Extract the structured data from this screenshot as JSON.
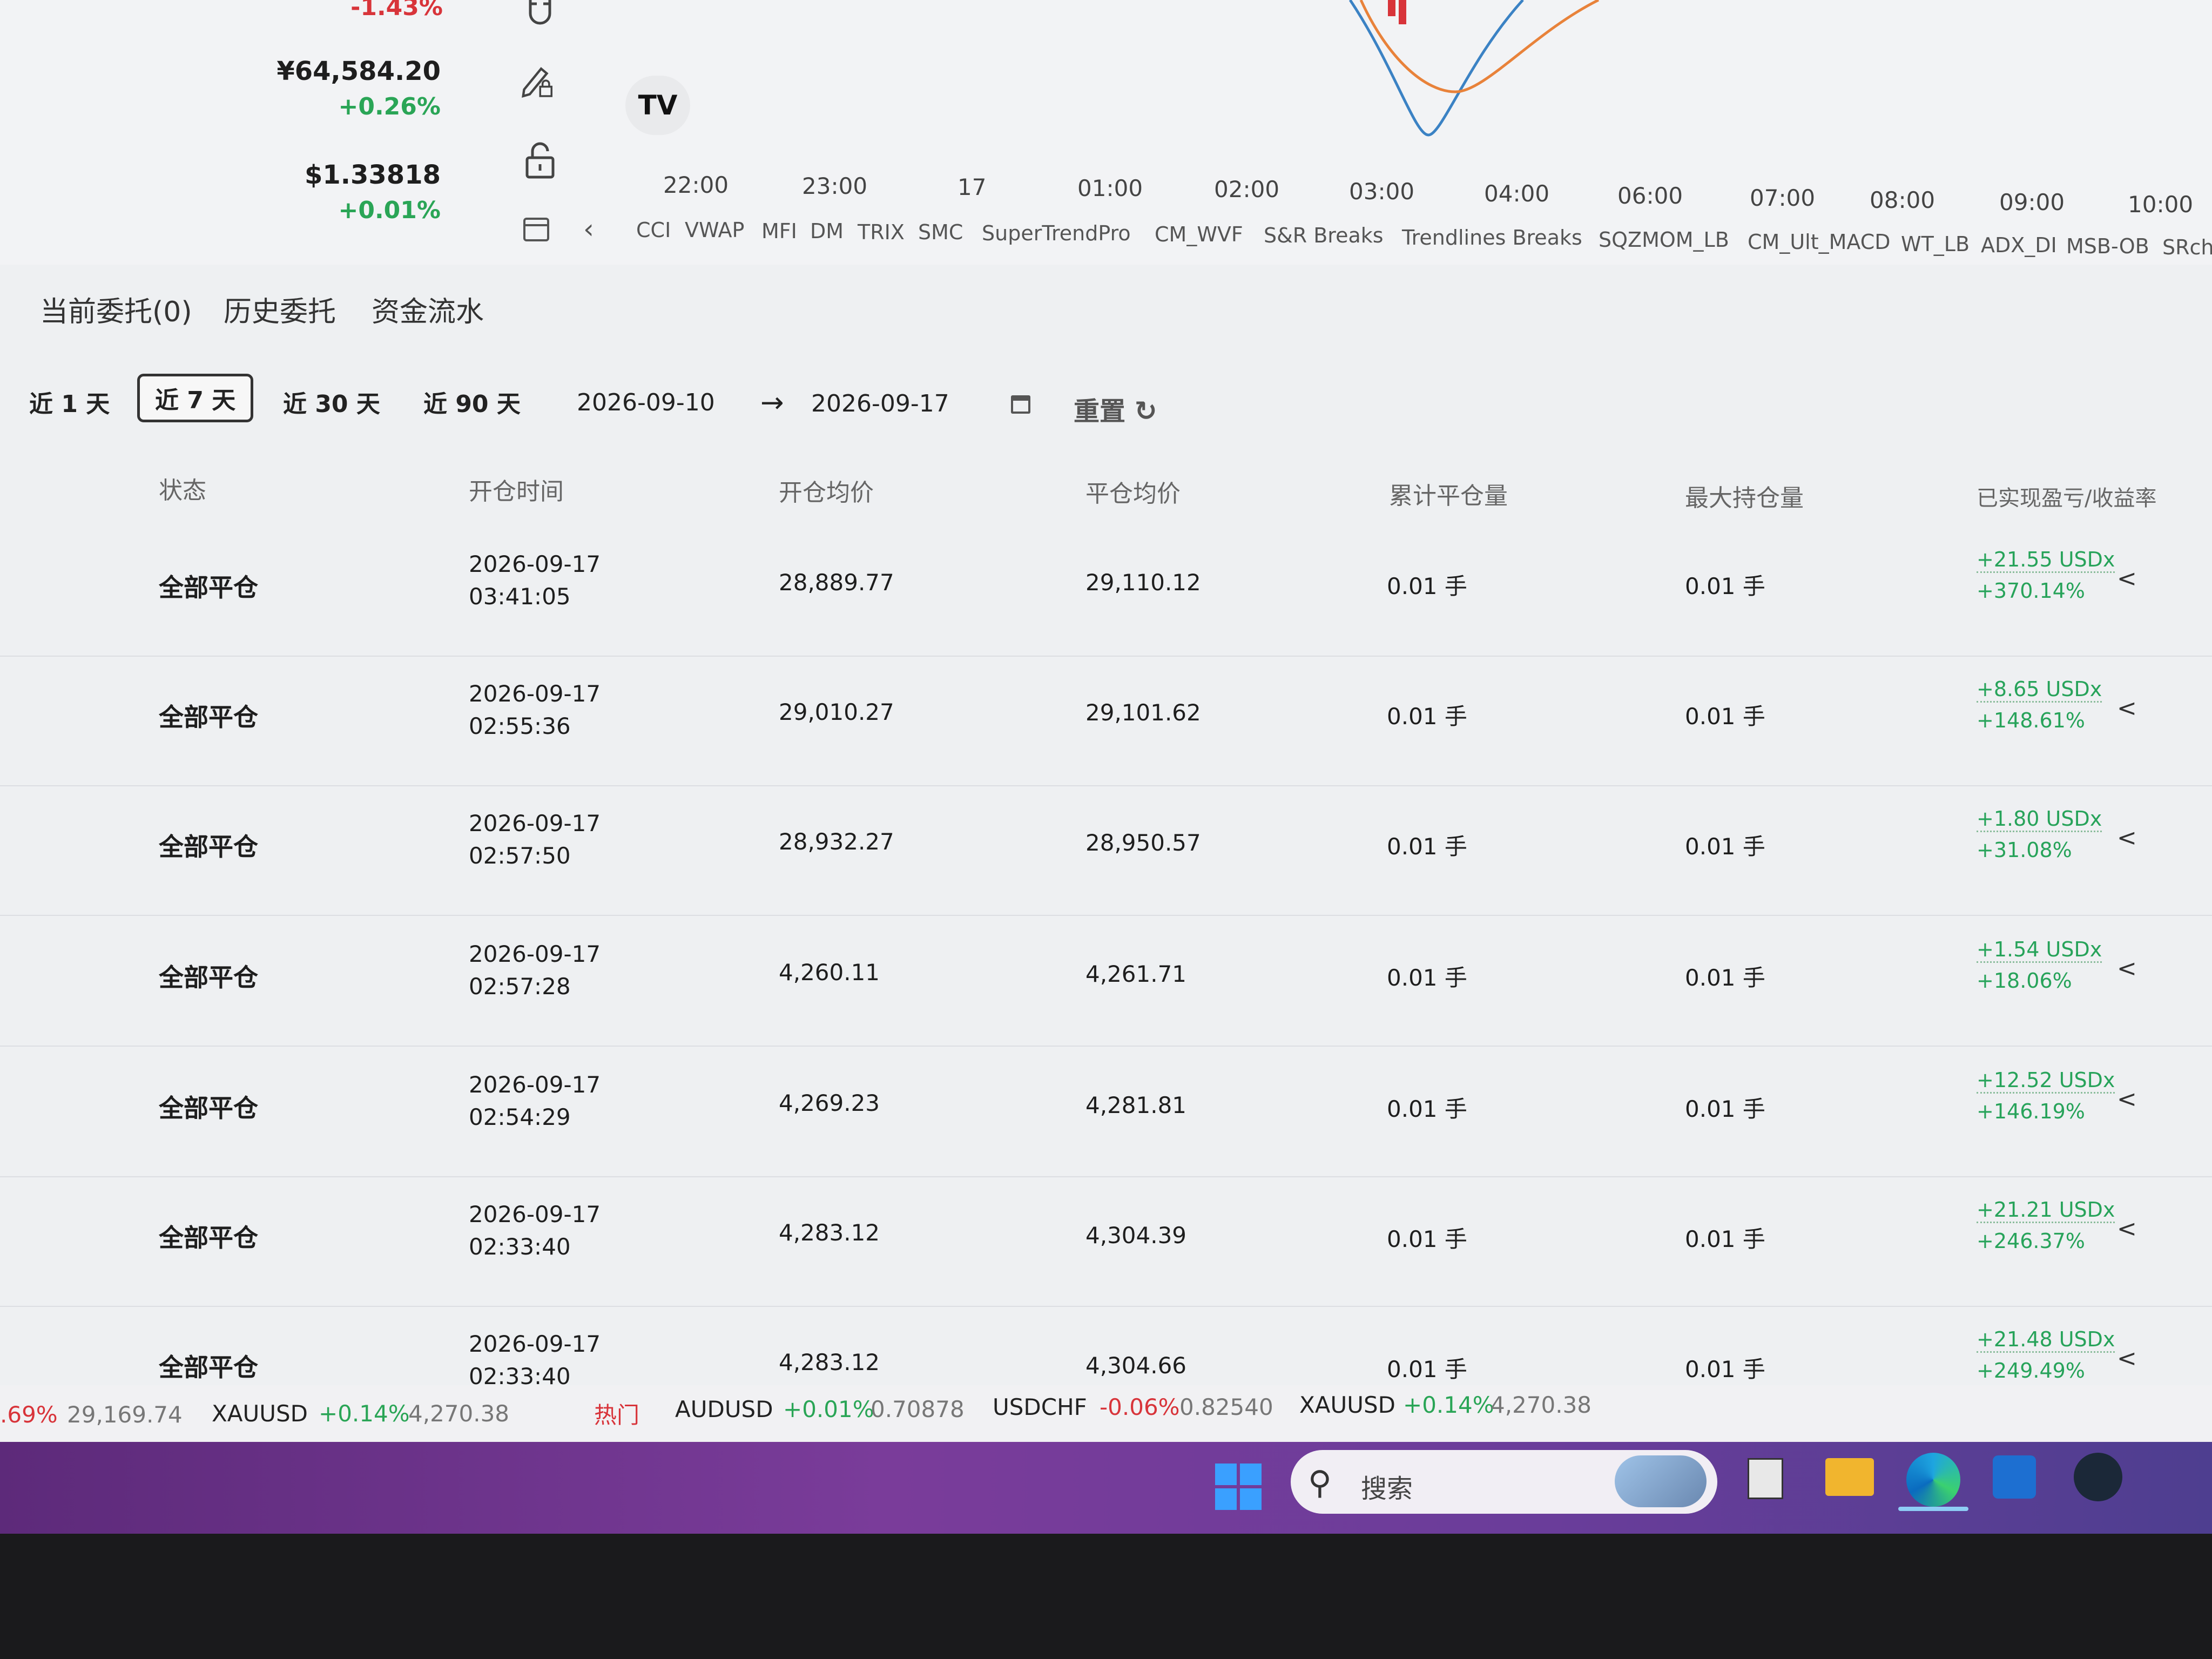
{
  "watchlist": [
    {
      "price": "",
      "change": "-1.43%",
      "dir": "neg"
    },
    {
      "price": "¥64,584.20",
      "change": "+0.26%",
      "dir": "pos"
    },
    {
      "price": "$1.33818",
      "change": "+0.01%",
      "dir": "pos"
    }
  ],
  "chart": {
    "logo": "TV",
    "time_ticks": [
      "22:00",
      "23:00",
      "17",
      "01:00",
      "02:00",
      "03:00",
      "04:00",
      "06:00",
      "07:00",
      "08:00",
      "09:00",
      "10:00"
    ],
    "indicators": [
      "CCI",
      "VWAP",
      "MFI",
      "DM",
      "TRIX",
      "SMC",
      "SuperTrendPro",
      "CM_WVF",
      "S&R Breaks",
      "Trendlines Breaks",
      "SQZMOM_LB",
      "CM_Ult_MACD",
      "WT_LB",
      "ADX_DI",
      "MSB-OB",
      "SRch"
    ]
  },
  "tabs": {
    "current_orders": "当前委托(0)",
    "history_orders": "历史委托",
    "fund_flow": "资金流水"
  },
  "filters": {
    "ranges": [
      "近 1 天",
      "近 7 天",
      "近 30 天",
      "近 90 天"
    ],
    "active_range": "近 7 天",
    "start_date": "2026-09-10",
    "arrow": "→",
    "end_date": "2026-09-17",
    "reset": "重置"
  },
  "table": {
    "headers": {
      "status": "状态",
      "open_time": "开仓时间",
      "open_avg": "开仓均价",
      "close_avg": "平仓均价",
      "total_closed": "累计平仓量",
      "max_position": "最大持仓量",
      "realized": "已实现盈亏/收益率"
    },
    "rows": [
      {
        "status": "全部平仓",
        "date": "2026-09-17",
        "time": "03:41:05",
        "open_avg": "28,889.77",
        "close_avg": "29,110.12",
        "closed": "0.01 手",
        "max_pos": "0.01 手",
        "pnl": "+21.55 USDx",
        "rate": "+370.14%"
      },
      {
        "status": "全部平仓",
        "date": "2026-09-17",
        "time": "02:55:36",
        "open_avg": "29,010.27",
        "close_avg": "29,101.62",
        "closed": "0.01 手",
        "max_pos": "0.01 手",
        "pnl": "+8.65 USDx",
        "rate": "+148.61%"
      },
      {
        "status": "全部平仓",
        "date": "2026-09-17",
        "time": "02:57:50",
        "open_avg": "28,932.27",
        "close_avg": "28,950.57",
        "closed": "0.01 手",
        "max_pos": "0.01 手",
        "pnl": "+1.80 USDx",
        "rate": "+31.08%"
      },
      {
        "status": "全部平仓",
        "date": "2026-09-17",
        "time": "02:57:28",
        "open_avg": "4,260.11",
        "close_avg": "4,261.71",
        "closed": "0.01 手",
        "max_pos": "0.01 手",
        "pnl": "+1.54 USDx",
        "rate": "+18.06%"
      },
      {
        "status": "全部平仓",
        "date": "2026-09-17",
        "time": "02:54:29",
        "open_avg": "4,269.23",
        "close_avg": "4,281.81",
        "closed": "0.01 手",
        "max_pos": "0.01 手",
        "pnl": "+12.52 USDx",
        "rate": "+146.19%"
      },
      {
        "status": "全部平仓",
        "date": "2026-09-17",
        "time": "02:33:40",
        "open_avg": "4,283.12",
        "close_avg": "4,304.39",
        "closed": "0.01 手",
        "max_pos": "0.01 手",
        "pnl": "+21.21 USDx",
        "rate": "+246.37%"
      },
      {
        "status": "全部平仓",
        "date": "2026-09-17",
        "time": "02:33:40",
        "open_avg": "4,283.12",
        "close_avg": "4,304.66",
        "closed": "0.01 手",
        "max_pos": "0.01 手",
        "pnl": "+21.48 USDx",
        "rate": "+249.49%"
      }
    ]
  },
  "ticker": [
    {
      "symbol": "",
      "change": ".69%",
      "price": "29,169.74",
      "dir": "red"
    },
    {
      "symbol": "XAUUSD",
      "change": "+0.14%",
      "price": "4,270.38",
      "dir": "green"
    },
    {
      "symbol": "",
      "change": "热门",
      "price": "",
      "dir": "red"
    },
    {
      "symbol": "AUDUSD",
      "change": "+0.01%",
      "price": "0.70878",
      "dir": "green"
    },
    {
      "symbol": "USDCHF",
      "change": "-0.06%",
      "price": "0.82540",
      "dir": "red"
    },
    {
      "symbol": "XAUUSD",
      "change": "+0.14%",
      "price": "4,270.38",
      "dir": "green"
    }
  ],
  "taskbar": {
    "search_placeholder": "搜索"
  },
  "colors": {
    "positive": "#2aa556",
    "negative": "#d8343a",
    "taskbar": "#6a3d9a"
  }
}
